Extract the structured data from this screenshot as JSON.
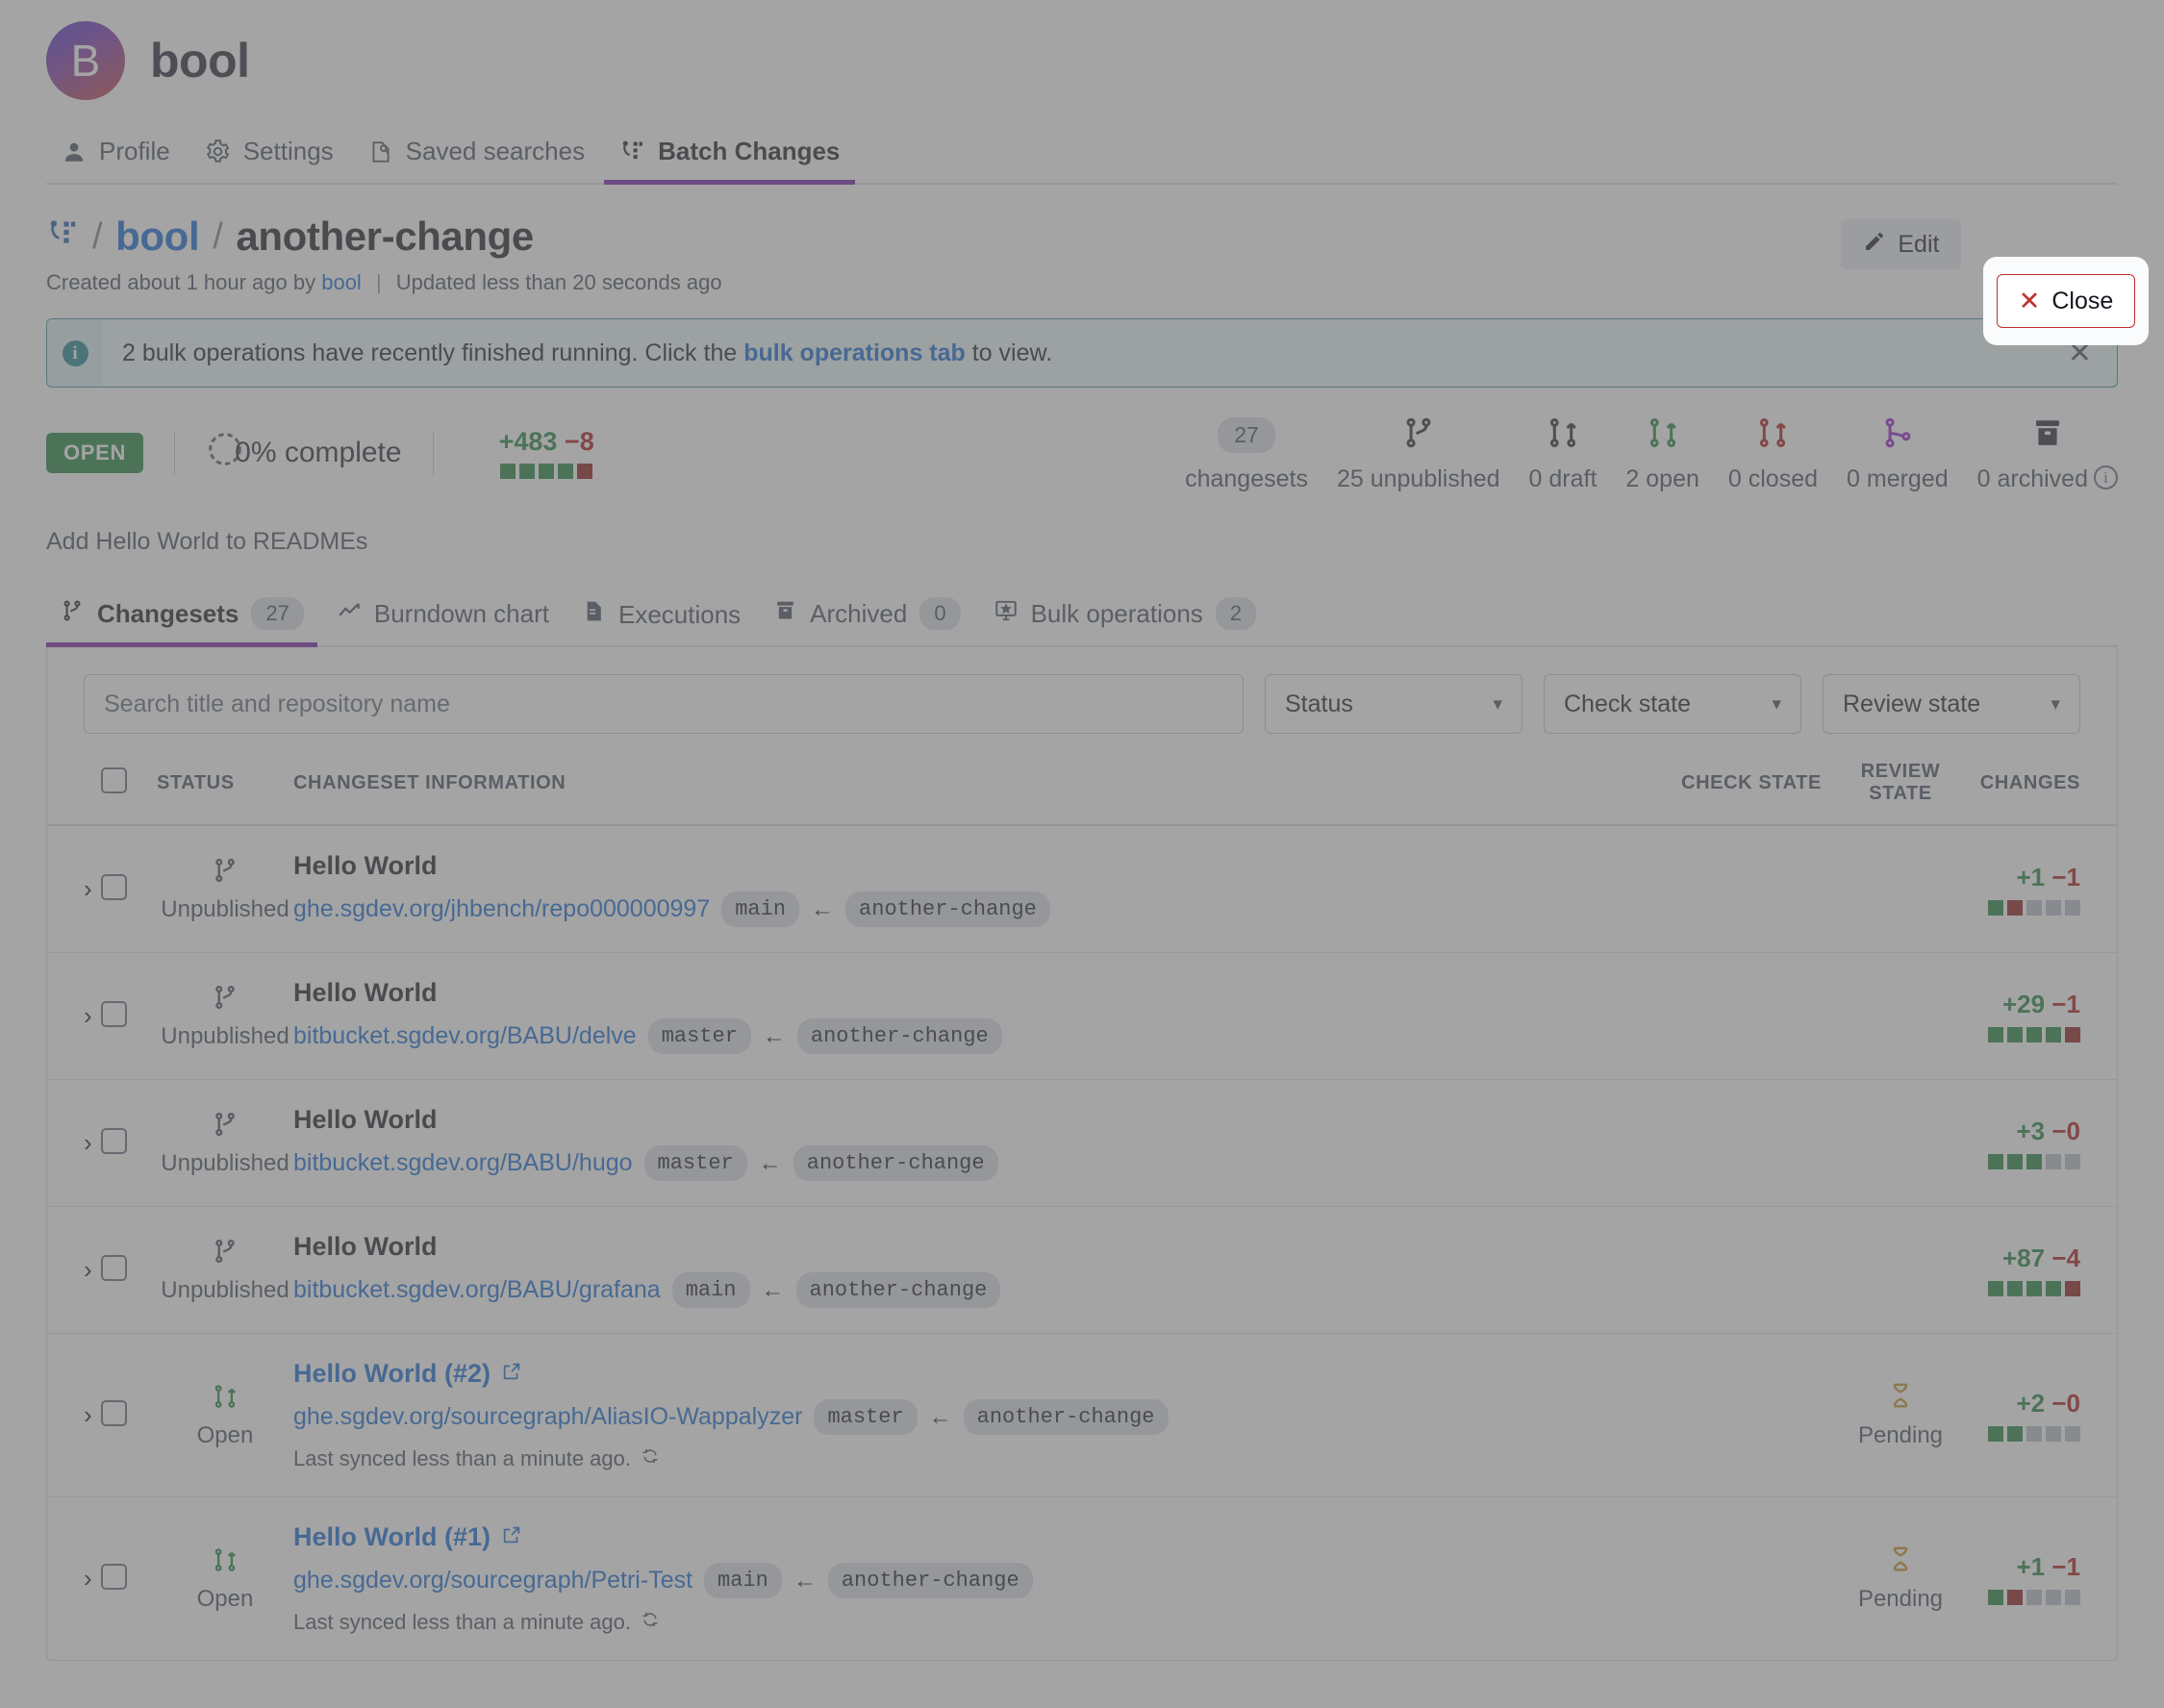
{
  "org": {
    "initial": "B",
    "name": "bool"
  },
  "topnav": {
    "items": [
      {
        "label": "Profile",
        "icon": "user-icon",
        "active": false
      },
      {
        "label": "Settings",
        "icon": "gear-icon",
        "active": false
      },
      {
        "label": "Saved searches",
        "icon": "saved-search-icon",
        "active": false
      },
      {
        "label": "Batch Changes",
        "icon": "batch-changes-icon",
        "active": true
      }
    ]
  },
  "header": {
    "breadcrumb_namespace": "bool",
    "breadcrumb_name": "another-change",
    "separator": "/",
    "created_prefix": "Created about 1 hour ago by",
    "created_by": "bool",
    "updated": "Updated less than 20 seconds ago",
    "edit_label": "Edit",
    "close_label": "Close",
    "edit_icon": "pencil-icon",
    "close_icon": "x-icon"
  },
  "banner": {
    "icon": "info-icon",
    "text_before": "2 bulk operations have recently finished running. Click the",
    "link": "bulk operations tab",
    "text_after": "to view.",
    "dismiss_icon": "close-icon"
  },
  "stats": {
    "state_badge": "OPEN",
    "progress": "0% complete",
    "progress_icon": "progress-check-icon",
    "diff_added": "+483",
    "diff_deleted": "−8",
    "diff_squares": [
      "g",
      "g",
      "g",
      "g",
      "r"
    ],
    "counts": [
      {
        "value": "27",
        "label": "changesets",
        "icon": "count-badge",
        "color": "#3e4759"
      },
      {
        "value": "25",
        "label": "25 unpublished",
        "icon": "branch-icon",
        "color": "#1d212f"
      },
      {
        "value": "0",
        "label": "0 draft",
        "icon": "pr-icon",
        "color": "#1d212f"
      },
      {
        "value": "2",
        "label": "2 open",
        "icon": "pr-icon",
        "color": "#1a7f37"
      },
      {
        "value": "0",
        "label": "0 closed",
        "icon": "pr-icon",
        "color": "#a80f0f"
      },
      {
        "value": "0",
        "label": "0 merged",
        "icon": "merge-icon",
        "color": "#8b17c7"
      },
      {
        "value": "0",
        "label": "0 archived",
        "icon": "archive-icon",
        "color": "#1d212f"
      }
    ],
    "info_icon": "info-circle-icon"
  },
  "description": "Add Hello World to READMEs",
  "section_tabs": [
    {
      "label": "Changesets",
      "count": "27",
      "icon": "branch-icon",
      "active": true
    },
    {
      "label": "Burndown chart",
      "count": null,
      "icon": "chart-line-icon",
      "active": false
    },
    {
      "label": "Executions",
      "count": null,
      "icon": "file-icon",
      "active": false
    },
    {
      "label": "Archived",
      "count": "0",
      "icon": "archive-icon",
      "active": false
    },
    {
      "label": "Bulk operations",
      "count": "2",
      "icon": "monitor-star-icon",
      "active": false
    }
  ],
  "filters": {
    "search_placeholder": "Search title and repository name",
    "search_value": "",
    "status_label": "Status",
    "check_state_label": "Check state",
    "review_state_label": "Review state"
  },
  "table": {
    "headers": {
      "status": "STATUS",
      "info": "CHANGESET INFORMATION",
      "check_state": "CHECK STATE",
      "review_state": "REVIEW STATE",
      "changes": "CHANGES"
    },
    "rows": [
      {
        "status": "Unpublished",
        "status_icon": "branch-icon",
        "status_color": "#3e4759",
        "title": "Hello World",
        "title_is_link": false,
        "external_link": false,
        "repo": "ghe.sgdev.org/jhbench/repo000000997",
        "base_branch": "main",
        "head_branch": "another-change",
        "synced": null,
        "check_state": null,
        "review_state": null,
        "added": "+1",
        "deleted": "−1",
        "squares": [
          "g",
          "r",
          "n",
          "n",
          "n"
        ]
      },
      {
        "status": "Unpublished",
        "status_icon": "branch-icon",
        "status_color": "#3e4759",
        "title": "Hello World",
        "title_is_link": false,
        "external_link": false,
        "repo": "bitbucket.sgdev.org/BABU/delve",
        "base_branch": "master",
        "head_branch": "another-change",
        "synced": null,
        "check_state": null,
        "review_state": null,
        "added": "+29",
        "deleted": "−1",
        "squares": [
          "g",
          "g",
          "g",
          "g",
          "r"
        ]
      },
      {
        "status": "Unpublished",
        "status_icon": "branch-icon",
        "status_color": "#3e4759",
        "title": "Hello World",
        "title_is_link": false,
        "external_link": false,
        "repo": "bitbucket.sgdev.org/BABU/hugo",
        "base_branch": "master",
        "head_branch": "another-change",
        "synced": null,
        "check_state": null,
        "review_state": null,
        "added": "+3",
        "deleted": "−0",
        "squares": [
          "g",
          "g",
          "g",
          "n",
          "n"
        ]
      },
      {
        "status": "Unpublished",
        "status_icon": "branch-icon",
        "status_color": "#3e4759",
        "title": "Hello World",
        "title_is_link": false,
        "external_link": false,
        "repo": "bitbucket.sgdev.org/BABU/grafana",
        "base_branch": "main",
        "head_branch": "another-change",
        "synced": null,
        "check_state": null,
        "review_state": null,
        "added": "+87",
        "deleted": "−4",
        "squares": [
          "g",
          "g",
          "g",
          "g",
          "r"
        ]
      },
      {
        "status": "Open",
        "status_icon": "pr-icon",
        "status_color": "#1a7f37",
        "title": "Hello World (#2)",
        "title_is_link": true,
        "external_link": true,
        "repo": "ghe.sgdev.org/sourcegraph/AliasIO-Wappalyzer",
        "base_branch": "master",
        "head_branch": "another-change",
        "synced": "Last synced less than a minute ago.",
        "check_state": null,
        "review_state": "Pending",
        "added": "+2",
        "deleted": "−0",
        "squares": [
          "g",
          "g",
          "n",
          "n",
          "n"
        ]
      },
      {
        "status": "Open",
        "status_icon": "pr-icon",
        "status_color": "#1a7f37",
        "title": "Hello World (#1)",
        "title_is_link": true,
        "external_link": true,
        "repo": "ghe.sgdev.org/sourcegraph/Petri-Test",
        "base_branch": "main",
        "head_branch": "another-change",
        "synced": "Last synced less than a minute ago.",
        "check_state": null,
        "review_state": "Pending",
        "added": "+1",
        "deleted": "−1",
        "squares": [
          "g",
          "r",
          "n",
          "n",
          "n"
        ]
      }
    ],
    "sync_icon": "refresh-icon",
    "expander_icon": "chevron-right-icon",
    "pending_icon": "hourglass-icon",
    "external_icon": "external-link-icon"
  },
  "spotlight": {
    "target": "close-button"
  }
}
